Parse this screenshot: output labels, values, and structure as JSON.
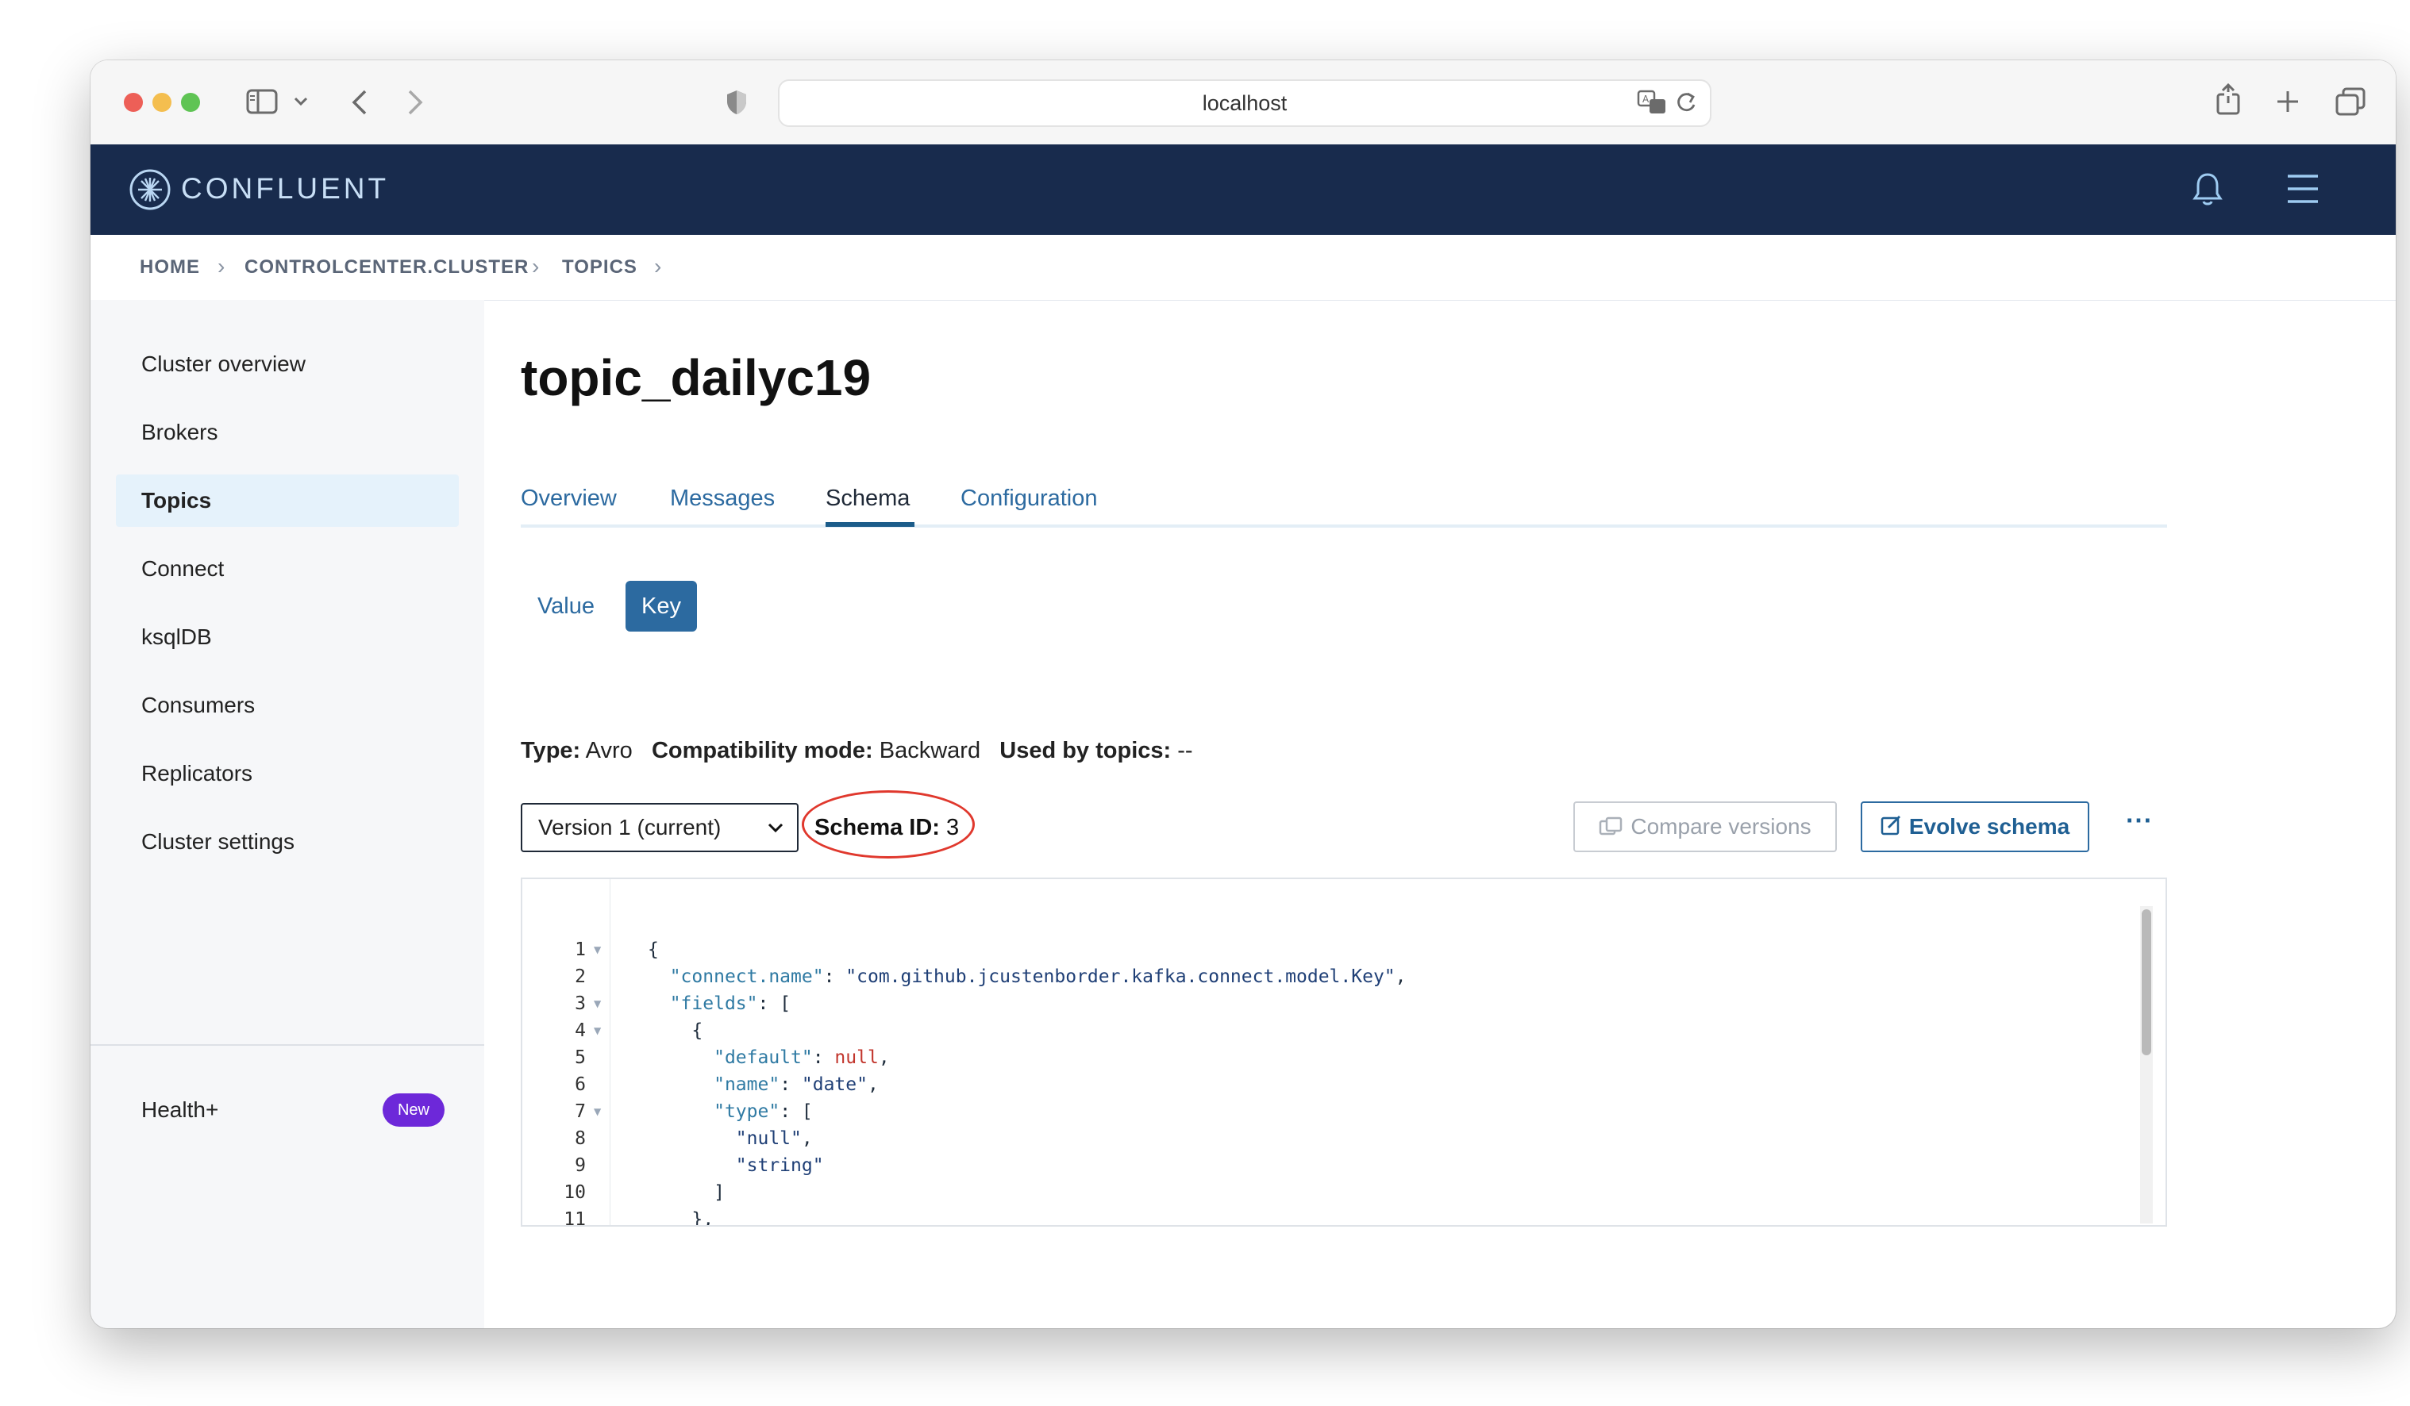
{
  "browser": {
    "url": "localhost"
  },
  "app": {
    "brand": "CONFLUENT"
  },
  "breadcrumb": {
    "items": [
      "HOME",
      "CONTROLCENTER.CLUSTER",
      "TOPICS"
    ]
  },
  "sidebar": {
    "items": [
      {
        "label": "Cluster overview",
        "active": false
      },
      {
        "label": "Brokers",
        "active": false
      },
      {
        "label": "Topics",
        "active": true
      },
      {
        "label": "Connect",
        "active": false
      },
      {
        "label": "ksqlDB",
        "active": false
      },
      {
        "label": "Consumers",
        "active": false
      },
      {
        "label": "Replicators",
        "active": false
      },
      {
        "label": "Cluster settings",
        "active": false
      }
    ],
    "health": {
      "label": "Health+",
      "badge": "New"
    }
  },
  "main": {
    "title": "topic_dailyc19",
    "tabs": [
      {
        "label": "Overview",
        "active": false
      },
      {
        "label": "Messages",
        "active": false
      },
      {
        "label": "Schema",
        "active": true
      },
      {
        "label": "Configuration",
        "active": false
      }
    ],
    "segment": {
      "value_label": "Value",
      "key_label": "Key",
      "selected": "Key"
    },
    "meta": {
      "type_label": "Type:",
      "type_value": "Avro",
      "compat_label": "Compatibility mode:",
      "compat_value": "Backward",
      "used_label": "Used by topics:",
      "used_value": "--"
    },
    "version_select": "Version 1 (current)",
    "schema_id": {
      "label": "Schema ID:",
      "value": "3"
    },
    "buttons": {
      "compare": "Compare versions",
      "evolve": "Evolve schema",
      "more": "⋯"
    }
  },
  "editor": {
    "lines": [
      {
        "n": "1",
        "fold": true
      },
      {
        "n": "2",
        "fold": false
      },
      {
        "n": "3",
        "fold": true
      },
      {
        "n": "4",
        "fold": true
      },
      {
        "n": "5",
        "fold": false
      },
      {
        "n": "6",
        "fold": false
      },
      {
        "n": "7",
        "fold": true
      },
      {
        "n": "8",
        "fold": false
      },
      {
        "n": "9",
        "fold": false
      },
      {
        "n": "10",
        "fold": false
      },
      {
        "n": "11",
        "fold": false
      }
    ],
    "tokens": {
      "l1_open": "{",
      "l2_key": "\"connect.name\"",
      "l2_val": "\"com.github.jcustenborder.kafka.connect.model.Key\"",
      "l3_key": "\"fields\"",
      "l3_open": "[",
      "l4_open": "{",
      "l5_key": "\"default\"",
      "l5_val": "null",
      "l6_key": "\"name\"",
      "l6_val": "\"date\"",
      "l7_key": "\"type\"",
      "l7_open": "[",
      "l8_val": "\"null\"",
      "l9_val": "\"string\"",
      "l10_close": "]",
      "l11_close": "},"
    }
  }
}
